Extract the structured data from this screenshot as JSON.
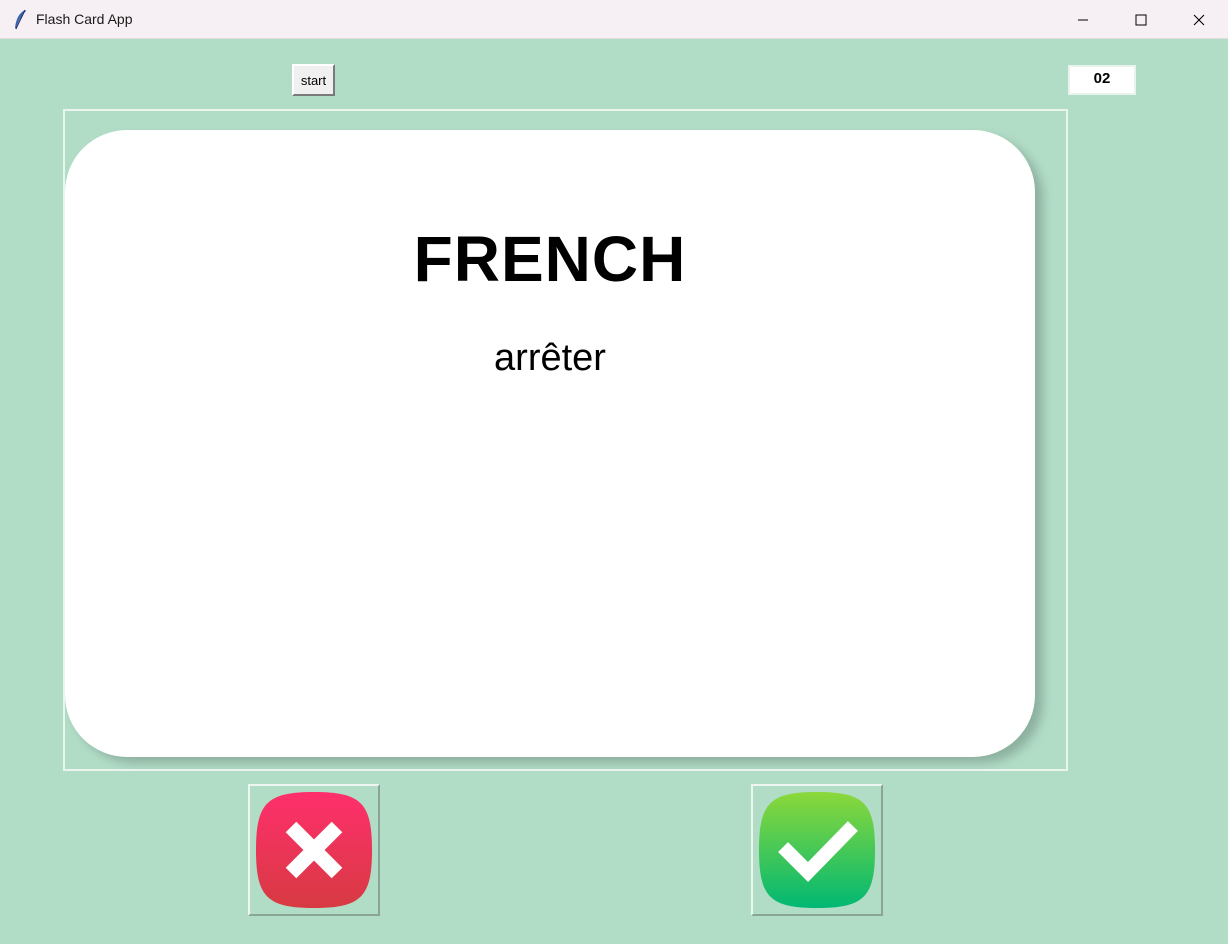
{
  "window": {
    "title": "Flash Card App",
    "app_icon": "feather-icon",
    "controls": [
      "minimize-icon",
      "maximize-icon",
      "close-icon"
    ]
  },
  "toolbar": {
    "start_label": "start",
    "counter": "02"
  },
  "card": {
    "language": "FRENCH",
    "word": "arrêter",
    "background_color": "#ffffff"
  },
  "buttons": {
    "wrong_icon": "cross-icon",
    "right_icon": "checkmark-icon"
  },
  "colors": {
    "window_background": "#b1dcc6",
    "wrong_button": "#e8334f",
    "right_button": "#1ec06a"
  }
}
